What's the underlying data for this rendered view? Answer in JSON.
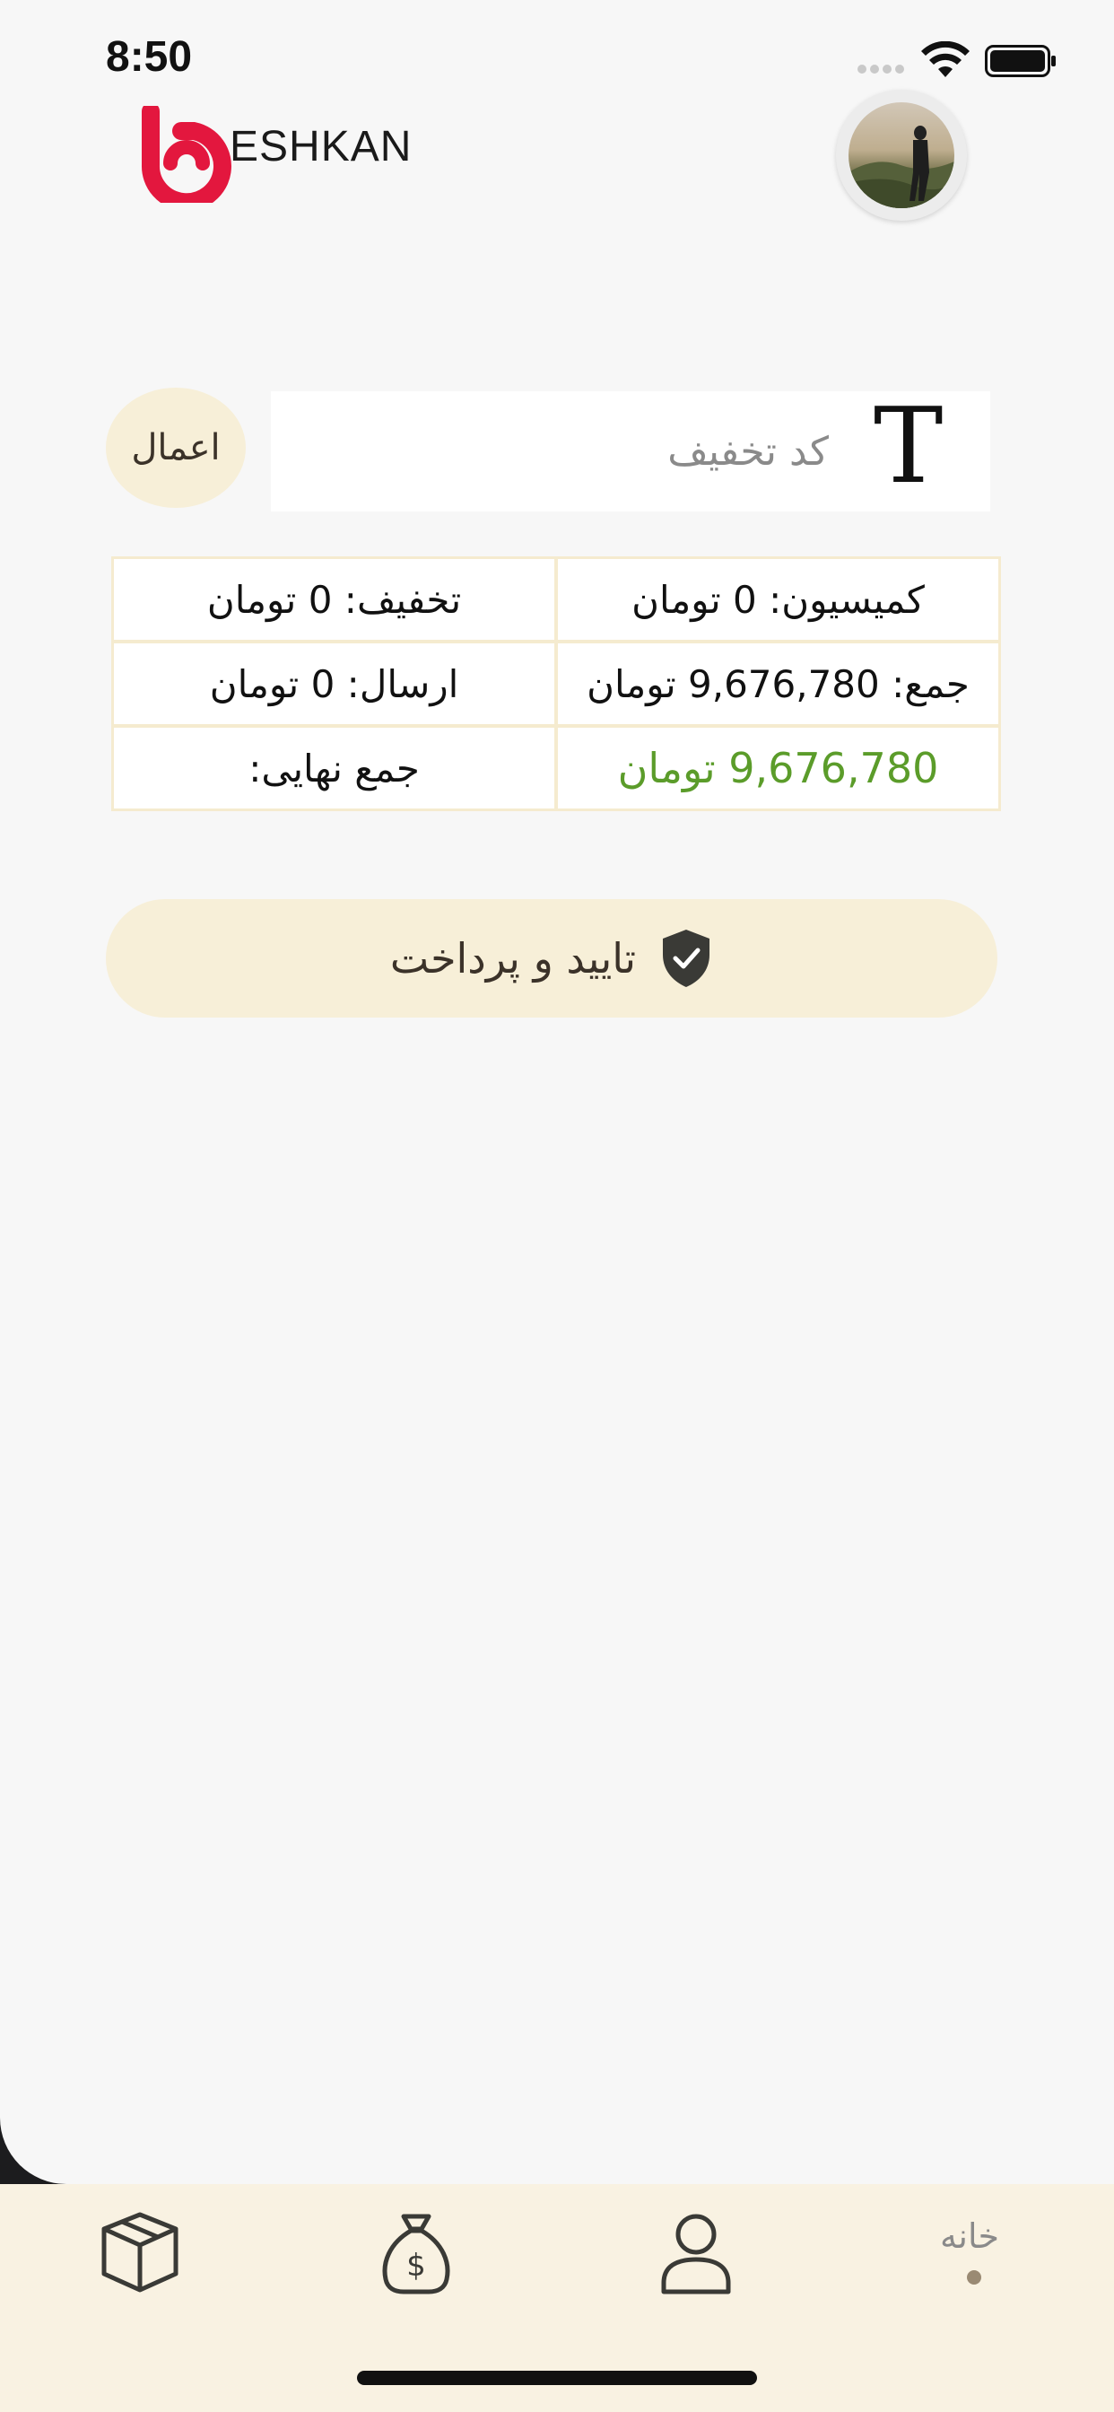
{
  "status_bar": {
    "time": "8:50"
  },
  "header": {
    "logo_text": "ESHKAN",
    "brand_color": "#e3173e"
  },
  "discount": {
    "apply_label": "اعمال",
    "placeholder": "کد تخفیف",
    "input_icon": "text-T-icon"
  },
  "summary": {
    "discount_text": "تخفیف: 0 تومان",
    "commission_text": "کمیسیون: 0 تومان",
    "shipping_text": "ارسال: 0 تومان",
    "total_text": "جمع: 9,676,780 تومان",
    "final_label": "جمع نهایی:",
    "final_value": "9,676,780  تومان",
    "final_value_color": "#5b9c2a"
  },
  "confirm": {
    "label": "تایید و پرداخت",
    "icon": "shield-check-icon"
  },
  "tabbar": {
    "items": [
      {
        "icon": "box-icon"
      },
      {
        "icon": "money-bag-icon"
      },
      {
        "icon": "user-icon"
      },
      {
        "label": "خانه",
        "active": true
      }
    ]
  }
}
